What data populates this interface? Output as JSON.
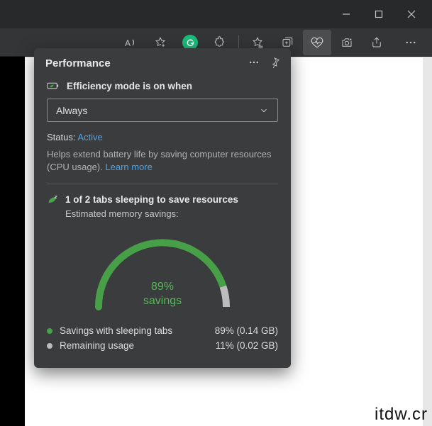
{
  "window": {
    "minimize_icon": "minimize-icon",
    "maximize_icon": "maximize-icon",
    "close_icon": "close-icon"
  },
  "toolbar": {
    "read_aloud_icon": "read-aloud-icon",
    "favorite_icon": "star-plus-icon",
    "grammarly_icon": "grammarly-icon",
    "extensions_icon": "puzzle-icon",
    "favorites_icon": "star-list-icon",
    "collections_icon": "collections-icon",
    "performance_icon": "heartbeat-icon",
    "screenshot_icon": "camera-plus-icon",
    "share_icon": "share-icon",
    "more_icon": "more-horizontal-icon"
  },
  "panel": {
    "title": "Performance",
    "menu_icon": "more-horizontal-icon",
    "pin_icon": "pin-icon",
    "efficiency": {
      "icon": "leaf-battery-icon",
      "label": "Efficiency mode is on when",
      "selected": "Always",
      "chevron_icon": "chevron-down-icon",
      "status_label": "Status:",
      "status_value": "Active",
      "help_text_1": "Helps extend battery life by saving computer resources (CPU usage). ",
      "learn_more": "Learn more"
    },
    "sleeping": {
      "icon": "sleeping-leaf-icon",
      "headline": "1 of 2 tabs sleeping to save resources",
      "subline": "Estimated memory savings:",
      "center_pct": "89%",
      "center_word": "savings",
      "legend": [
        {
          "color": "#47a047",
          "name": "Savings with sleeping tabs",
          "value": "89% (0.14 GB)"
        },
        {
          "color": "#bdbdbd",
          "name": "Remaining usage",
          "value": "11% (0.02 GB)"
        }
      ]
    }
  },
  "chart_data": {
    "type": "pie",
    "title": "Estimated memory savings",
    "series": [
      {
        "name": "Savings with sleeping tabs",
        "value": 89,
        "gb": 0.14,
        "color": "#47a047"
      },
      {
        "name": "Remaining usage",
        "value": 11,
        "gb": 0.02,
        "color": "#bdbdbd"
      }
    ],
    "center_label": "89% savings",
    "display": "semicircle-gauge"
  },
  "watermark": "itdw.cr"
}
